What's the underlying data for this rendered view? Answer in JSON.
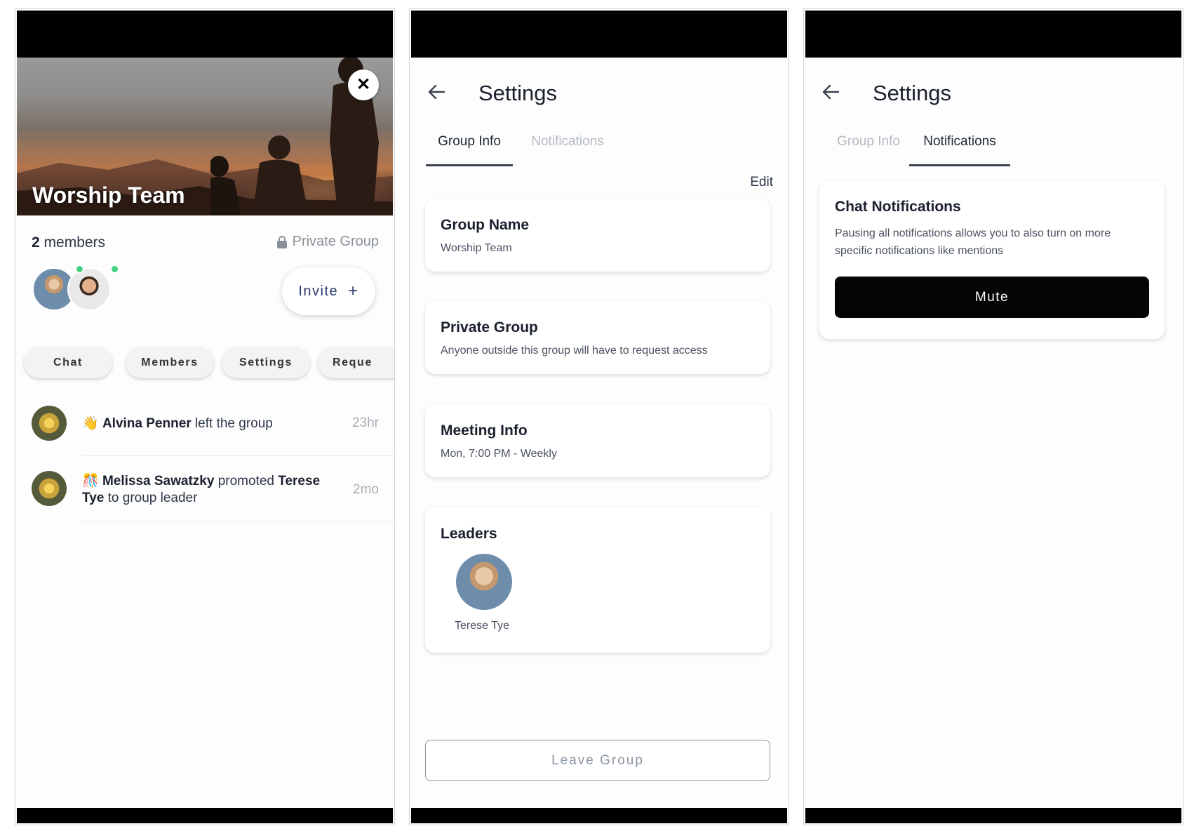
{
  "screen1": {
    "group_title": "Worship Team",
    "members_count": "2",
    "members_label": " members",
    "privacy_label": "Private Group",
    "invite_label": "Invite",
    "invite_icon": "+",
    "close_icon": "✕",
    "tabs": [
      "Chat",
      "Members",
      "Settings",
      "Reque"
    ],
    "feed": [
      {
        "emoji": "👋",
        "actor": "Alvina Penner",
        "action": " left the group",
        "time": "23hr"
      },
      {
        "emoji": "🎊",
        "actor": "Melissa Sawatzky",
        "action": " promoted ",
        "target": "Terese Tye",
        "suffix": " to group leader",
        "time": "2mo"
      }
    ]
  },
  "screen2": {
    "title": "Settings",
    "tabs": {
      "group_info": "Group Info",
      "notifications": "Notifications"
    },
    "edit_label": "Edit",
    "group_name": {
      "title": "Group Name",
      "value": "Worship Team"
    },
    "private_group": {
      "title": "Private Group",
      "value": "Anyone outside this group will have to request access"
    },
    "meeting_info": {
      "title": "Meeting Info",
      "value": "Mon, 7:00 PM - Weekly"
    },
    "leaders": {
      "title": "Leaders",
      "names": [
        "Terese Tye"
      ]
    },
    "leave_label": "Leave Group"
  },
  "screen3": {
    "title": "Settings",
    "tabs": {
      "group_info": "Group Info",
      "notifications": "Notifications"
    },
    "chat_notifications": {
      "title": "Chat Notifications",
      "description": "Pausing all notifications allows you to also turn on more specific notifications like mentions",
      "mute_label": "Mute"
    }
  },
  "colors": {
    "online": "#45d483",
    "accent_text": "#2a3a6b",
    "primary_button": "#050505"
  }
}
